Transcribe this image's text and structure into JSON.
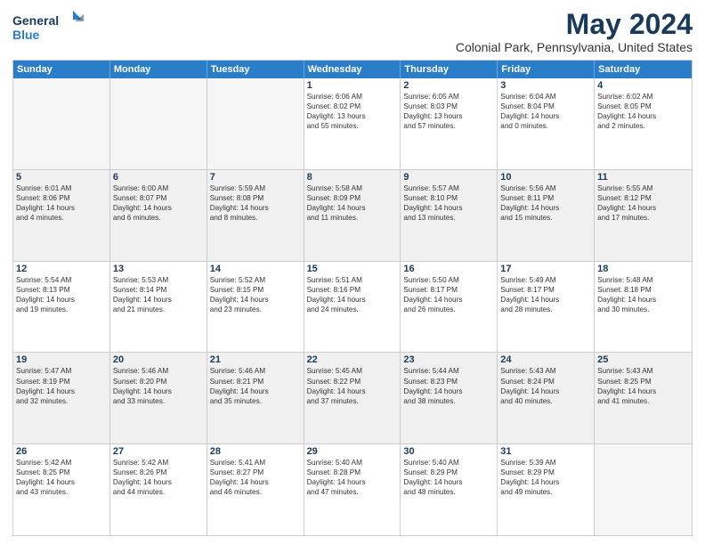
{
  "header": {
    "logo_line1": "General",
    "logo_line2": "Blue",
    "title": "May 2024",
    "subtitle": "Colonial Park, Pennsylvania, United States"
  },
  "weekdays": [
    "Sunday",
    "Monday",
    "Tuesday",
    "Wednesday",
    "Thursday",
    "Friday",
    "Saturday"
  ],
  "rows": [
    [
      {
        "day": "",
        "detail": ""
      },
      {
        "day": "",
        "detail": ""
      },
      {
        "day": "",
        "detail": ""
      },
      {
        "day": "1",
        "detail": "Sunrise: 6:06 AM\nSunset: 8:02 PM\nDaylight: 13 hours\nand 55 minutes."
      },
      {
        "day": "2",
        "detail": "Sunrise: 6:05 AM\nSunset: 8:03 PM\nDaylight: 13 hours\nand 57 minutes."
      },
      {
        "day": "3",
        "detail": "Sunrise: 6:04 AM\nSunset: 8:04 PM\nDaylight: 14 hours\nand 0 minutes."
      },
      {
        "day": "4",
        "detail": "Sunrise: 6:02 AM\nSunset: 8:05 PM\nDaylight: 14 hours\nand 2 minutes."
      }
    ],
    [
      {
        "day": "5",
        "detail": "Sunrise: 6:01 AM\nSunset: 8:06 PM\nDaylight: 14 hours\nand 4 minutes."
      },
      {
        "day": "6",
        "detail": "Sunrise: 6:00 AM\nSunset: 8:07 PM\nDaylight: 14 hours\nand 6 minutes."
      },
      {
        "day": "7",
        "detail": "Sunrise: 5:59 AM\nSunset: 8:08 PM\nDaylight: 14 hours\nand 8 minutes."
      },
      {
        "day": "8",
        "detail": "Sunrise: 5:58 AM\nSunset: 8:09 PM\nDaylight: 14 hours\nand 11 minutes."
      },
      {
        "day": "9",
        "detail": "Sunrise: 5:57 AM\nSunset: 8:10 PM\nDaylight: 14 hours\nand 13 minutes."
      },
      {
        "day": "10",
        "detail": "Sunrise: 5:56 AM\nSunset: 8:11 PM\nDaylight: 14 hours\nand 15 minutes."
      },
      {
        "day": "11",
        "detail": "Sunrise: 5:55 AM\nSunset: 8:12 PM\nDaylight: 14 hours\nand 17 minutes."
      }
    ],
    [
      {
        "day": "12",
        "detail": "Sunrise: 5:54 AM\nSunset: 8:13 PM\nDaylight: 14 hours\nand 19 minutes."
      },
      {
        "day": "13",
        "detail": "Sunrise: 5:53 AM\nSunset: 8:14 PM\nDaylight: 14 hours\nand 21 minutes."
      },
      {
        "day": "14",
        "detail": "Sunrise: 5:52 AM\nSunset: 8:15 PM\nDaylight: 14 hours\nand 23 minutes."
      },
      {
        "day": "15",
        "detail": "Sunrise: 5:51 AM\nSunset: 8:16 PM\nDaylight: 14 hours\nand 24 minutes."
      },
      {
        "day": "16",
        "detail": "Sunrise: 5:50 AM\nSunset: 8:17 PM\nDaylight: 14 hours\nand 26 minutes."
      },
      {
        "day": "17",
        "detail": "Sunrise: 5:49 AM\nSunset: 8:17 PM\nDaylight: 14 hours\nand 28 minutes."
      },
      {
        "day": "18",
        "detail": "Sunrise: 5:48 AM\nSunset: 8:18 PM\nDaylight: 14 hours\nand 30 minutes."
      }
    ],
    [
      {
        "day": "19",
        "detail": "Sunrise: 5:47 AM\nSunset: 8:19 PM\nDaylight: 14 hours\nand 32 minutes."
      },
      {
        "day": "20",
        "detail": "Sunrise: 5:46 AM\nSunset: 8:20 PM\nDaylight: 14 hours\nand 33 minutes."
      },
      {
        "day": "21",
        "detail": "Sunrise: 5:46 AM\nSunset: 8:21 PM\nDaylight: 14 hours\nand 35 minutes."
      },
      {
        "day": "22",
        "detail": "Sunrise: 5:45 AM\nSunset: 8:22 PM\nDaylight: 14 hours\nand 37 minutes."
      },
      {
        "day": "23",
        "detail": "Sunrise: 5:44 AM\nSunset: 8:23 PM\nDaylight: 14 hours\nand 38 minutes."
      },
      {
        "day": "24",
        "detail": "Sunrise: 5:43 AM\nSunset: 8:24 PM\nDaylight: 14 hours\nand 40 minutes."
      },
      {
        "day": "25",
        "detail": "Sunrise: 5:43 AM\nSunset: 8:25 PM\nDaylight: 14 hours\nand 41 minutes."
      }
    ],
    [
      {
        "day": "26",
        "detail": "Sunrise: 5:42 AM\nSunset: 8:25 PM\nDaylight: 14 hours\nand 43 minutes."
      },
      {
        "day": "27",
        "detail": "Sunrise: 5:42 AM\nSunset: 8:26 PM\nDaylight: 14 hours\nand 44 minutes."
      },
      {
        "day": "28",
        "detail": "Sunrise: 5:41 AM\nSunset: 8:27 PM\nDaylight: 14 hours\nand 46 minutes."
      },
      {
        "day": "29",
        "detail": "Sunrise: 5:40 AM\nSunset: 8:28 PM\nDaylight: 14 hours\nand 47 minutes."
      },
      {
        "day": "30",
        "detail": "Sunrise: 5:40 AM\nSunset: 8:29 PM\nDaylight: 14 hours\nand 48 minutes."
      },
      {
        "day": "31",
        "detail": "Sunrise: 5:39 AM\nSunset: 8:29 PM\nDaylight: 14 hours\nand 49 minutes."
      },
      {
        "day": "",
        "detail": ""
      }
    ]
  ]
}
